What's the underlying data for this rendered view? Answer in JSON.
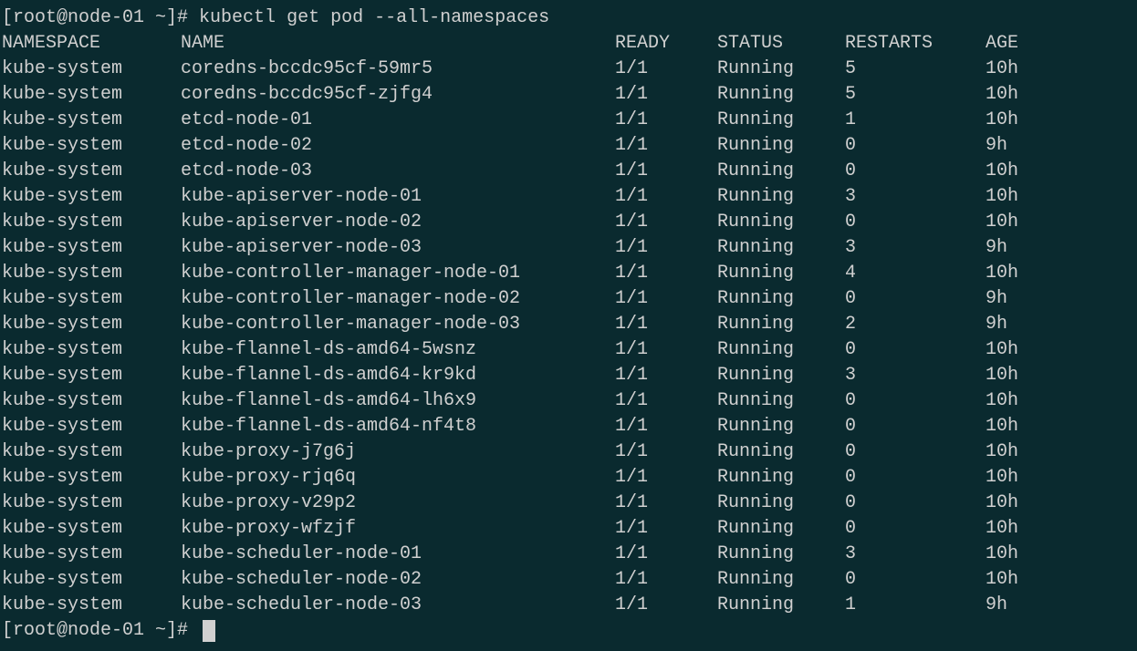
{
  "prompt1": "[root@node-01 ~]# ",
  "command": "kubectl get pod --all-namespaces",
  "prompt2": "[root@node-01 ~]# ",
  "headers": {
    "namespace": "NAMESPACE",
    "name": "NAME",
    "ready": "READY",
    "status": "STATUS",
    "restarts": "RESTARTS",
    "age": "AGE"
  },
  "rows": [
    {
      "ns": "kube-system",
      "name": "coredns-bccdc95cf-59mr5",
      "ready": "1/1",
      "status": "Running",
      "restarts": "5",
      "age": "10h"
    },
    {
      "ns": "kube-system",
      "name": "coredns-bccdc95cf-zjfg4",
      "ready": "1/1",
      "status": "Running",
      "restarts": "5",
      "age": "10h"
    },
    {
      "ns": "kube-system",
      "name": "etcd-node-01",
      "ready": "1/1",
      "status": "Running",
      "restarts": "1",
      "age": "10h"
    },
    {
      "ns": "kube-system",
      "name": "etcd-node-02",
      "ready": "1/1",
      "status": "Running",
      "restarts": "0",
      "age": "9h"
    },
    {
      "ns": "kube-system",
      "name": "etcd-node-03",
      "ready": "1/1",
      "status": "Running",
      "restarts": "0",
      "age": "10h"
    },
    {
      "ns": "kube-system",
      "name": "kube-apiserver-node-01",
      "ready": "1/1",
      "status": "Running",
      "restarts": "3",
      "age": "10h"
    },
    {
      "ns": "kube-system",
      "name": "kube-apiserver-node-02",
      "ready": "1/1",
      "status": "Running",
      "restarts": "0",
      "age": "10h"
    },
    {
      "ns": "kube-system",
      "name": "kube-apiserver-node-03",
      "ready": "1/1",
      "status": "Running",
      "restarts": "3",
      "age": "9h"
    },
    {
      "ns": "kube-system",
      "name": "kube-controller-manager-node-01",
      "ready": "1/1",
      "status": "Running",
      "restarts": "4",
      "age": "10h"
    },
    {
      "ns": "kube-system",
      "name": "kube-controller-manager-node-02",
      "ready": "1/1",
      "status": "Running",
      "restarts": "0",
      "age": "9h"
    },
    {
      "ns": "kube-system",
      "name": "kube-controller-manager-node-03",
      "ready": "1/1",
      "status": "Running",
      "restarts": "2",
      "age": "9h"
    },
    {
      "ns": "kube-system",
      "name": "kube-flannel-ds-amd64-5wsnz",
      "ready": "1/1",
      "status": "Running",
      "restarts": "0",
      "age": "10h"
    },
    {
      "ns": "kube-system",
      "name": "kube-flannel-ds-amd64-kr9kd",
      "ready": "1/1",
      "status": "Running",
      "restarts": "3",
      "age": "10h"
    },
    {
      "ns": "kube-system",
      "name": "kube-flannel-ds-amd64-lh6x9",
      "ready": "1/1",
      "status": "Running",
      "restarts": "0",
      "age": "10h"
    },
    {
      "ns": "kube-system",
      "name": "kube-flannel-ds-amd64-nf4t8",
      "ready": "1/1",
      "status": "Running",
      "restarts": "0",
      "age": "10h"
    },
    {
      "ns": "kube-system",
      "name": "kube-proxy-j7g6j",
      "ready": "1/1",
      "status": "Running",
      "restarts": "0",
      "age": "10h"
    },
    {
      "ns": "kube-system",
      "name": "kube-proxy-rjq6q",
      "ready": "1/1",
      "status": "Running",
      "restarts": "0",
      "age": "10h"
    },
    {
      "ns": "kube-system",
      "name": "kube-proxy-v29p2",
      "ready": "1/1",
      "status": "Running",
      "restarts": "0",
      "age": "10h"
    },
    {
      "ns": "kube-system",
      "name": "kube-proxy-wfzjf",
      "ready": "1/1",
      "status": "Running",
      "restarts": "0",
      "age": "10h"
    },
    {
      "ns": "kube-system",
      "name": "kube-scheduler-node-01",
      "ready": "1/1",
      "status": "Running",
      "restarts": "3",
      "age": "10h"
    },
    {
      "ns": "kube-system",
      "name": "kube-scheduler-node-02",
      "ready": "1/1",
      "status": "Running",
      "restarts": "0",
      "age": "10h"
    },
    {
      "ns": "kube-system",
      "name": "kube-scheduler-node-03",
      "ready": "1/1",
      "status": "Running",
      "restarts": "1",
      "age": "9h"
    }
  ]
}
